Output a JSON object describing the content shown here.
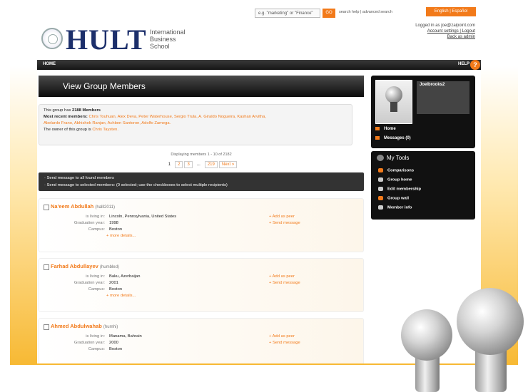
{
  "topbar": {
    "search_placeholder": "e.g. \"marketing\" or \"Finance\"",
    "search_go": "GO",
    "search_links": "search help | advanced search",
    "language": "English | Español"
  },
  "account": {
    "logged_in": "Logged in as joe@zaipoint.com",
    "links": "Account settings | Logout",
    "back": "Back as admin"
  },
  "logo": {
    "word": "HULT",
    "line1": "International",
    "line2": "Business",
    "line3": "School"
  },
  "nav": {
    "home": "HOME",
    "help": "HELP",
    "help_icon": "?"
  },
  "page": {
    "title": "View Group Members",
    "members_prefix": "This group has",
    "members_count": "2188 Members",
    "recent_label": "Most recent members:",
    "recent_1": "Chris Touhuan, Alex Deva, Peter Waterhouse, Sergio Trula, A. Giraldo Nogueira, Kashan Arvitha,",
    "recent_2": "Abelardo Frano, Abhishek Ranjan, Achben Santoron, Adolfo Zamega.",
    "owner_prefix": "The owner of this group is",
    "owner": "Chris Taysten.",
    "displaying": "Displaying members 1 - 10 of 2182",
    "pages": [
      "1",
      "2",
      "3",
      "...",
      "219",
      "Next »"
    ],
    "action_1": "· Send message to all found members",
    "action_2": "· Send message to selected members: (0 selected; use the checkboxes to select multiple recipients)"
  },
  "labels": {
    "living": "is living in:",
    "grad": "Graduation year:",
    "campus": "Campus:"
  },
  "members": [
    {
      "name": "Na'eem Abdullah",
      "handle": "(halll2011)",
      "living": "Lincoln, Pennsylvania, United States",
      "grad": "1998",
      "campus": "Boston",
      "more": "+ more details...",
      "peer": "+ Add as peer",
      "message": "+ Send message"
    },
    {
      "name": "Farhad Abdullayev",
      "handle": "(humbled)",
      "living": "Baku, Azerbaijan",
      "grad": "2001",
      "campus": "Boston",
      "more": "+ more details...",
      "peer": "+ Add as peer",
      "message": "+ Send message"
    },
    {
      "name": "Ahmed Abdulwahab",
      "handle": "(humhi)",
      "living": "Manama, Bahrain",
      "grad": "2000",
      "campus": "Boston",
      "more": "",
      "peer": "+ Add as peer",
      "message": "+ Send message"
    }
  ],
  "profile": {
    "username": "Joelbrooks2",
    "home": "Home",
    "messages": "Messages (0)"
  },
  "tools": {
    "title": "My Tools",
    "items": [
      "Comparisons",
      "Group home",
      "Edit membership",
      "Group wall",
      "Member info"
    ]
  }
}
